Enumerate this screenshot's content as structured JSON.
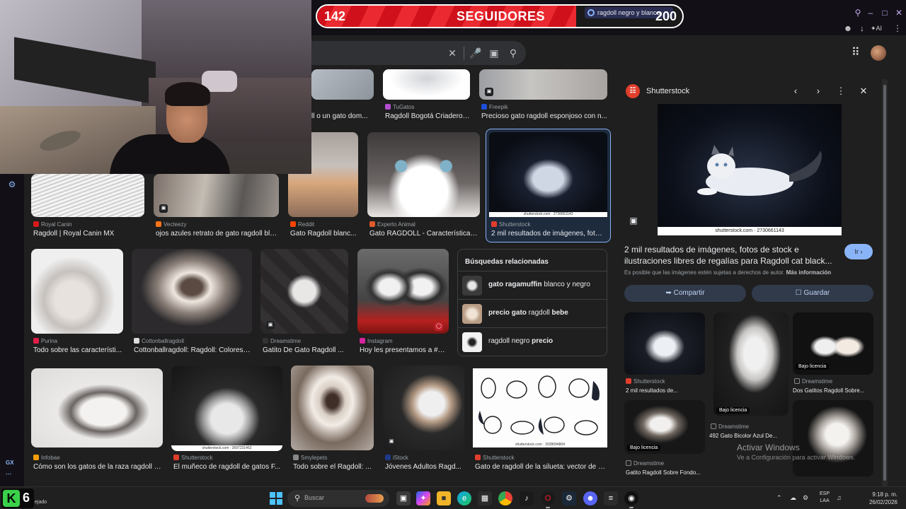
{
  "followers": {
    "current": 142,
    "label": "SEGUIDORES",
    "goal": 200,
    "progress_fraction": 0.71,
    "tab_title": "ragdoll negro y blanco"
  },
  "taskbar": {
    "logo_letter": "K",
    "logo_number": "6",
    "weather_text": "ejado",
    "search_label": "Buscar",
    "lang_top": "ESP",
    "lang_bottom": "LAA",
    "time": "9:18 p. m.",
    "date": "26/02/2026"
  },
  "rail": {
    "gx_label": "GX"
  },
  "grid": {
    "row0": [
      {
        "title": "ll o un gato dom..."
      },
      {
        "source": "TuGatos",
        "title": "Ragdoll Bogotá Criadero ..."
      },
      {
        "source": "Freepik",
        "title": "Precioso gato ragdoll esponjoso con n..."
      }
    ],
    "row1": [
      {
        "source": "Royal Canin",
        "title": "Ragdoll | Royal Canin MX"
      },
      {
        "source": "Vecteezy",
        "title": "ojos azules retrato de gato ragdoll bla..."
      },
      {
        "source": "Reddit",
        "title": "Gato Ragdoll blanc..."
      },
      {
        "source": "Experto Animal",
        "title": "Gato RAGDOLL - Características,..."
      },
      {
        "source": "Shutterstock",
        "title": "2 mil resultados de imágenes, foto..."
      }
    ],
    "row2": [
      {
        "source": "Purina",
        "title": "Todo sobre las característi..."
      },
      {
        "source": "Cottonballragdoll",
        "title": "Cottonballragdoll: Ragdoll: Colores ..."
      },
      {
        "source": "Dreamstime",
        "title": "Gatito De Gato Ragdoll ..."
      },
      {
        "source": "Instagram",
        "title": "Hoy les presentamos a #P..."
      }
    ],
    "row3": [
      {
        "source": "Infobae",
        "title": "Cómo son los gatos de la raza ragdoll - ..."
      },
      {
        "source": "Shutterstock",
        "title": "El muñeco de ragdoll de gatos F..."
      },
      {
        "source": "Smylepets",
        "title": "Todo sobre el Ragdoll: ..."
      },
      {
        "source": "iStock",
        "title": "Jóvenes Adultos Ragd..."
      },
      {
        "source": "Shutterstock",
        "title": "Gato de ragdoll de la silueta: vector de s..."
      }
    ],
    "selected_caption": "shutterstock.com · 2730661143",
    "shutter_caption": "shutterstock.com · 2697231462",
    "shutter_caption_b": "shutterstock.com · 2028094804"
  },
  "related": {
    "heading": "Búsquedas relacionadas",
    "items": [
      {
        "bold": "gato ragamuffin",
        "rest": " blanco y negro"
      },
      {
        "bold": "precio gato",
        "rest": " ragdoll ",
        "bold2": "bebe"
      },
      {
        "bold": "",
        "rest": "ragdoll negro ",
        "bold2": "precio"
      }
    ]
  },
  "panel": {
    "site": "Shutterstock",
    "image_caption": "shutterstock.com · 2730661143",
    "title": "2 mil resultados de imágenes, fotos de stock e ilustraciones libres de regalías para Ragdoll cat black...",
    "go_label": "Ir",
    "note": "Es posible que las imágenes estén sujetas a derechos de autor.",
    "note_link": "Más información",
    "share_label": "Compartir",
    "save_label": "Guardar",
    "tiles": [
      {
        "source": "Shutterstock",
        "title": "2 mil resultados de..."
      },
      {
        "source": "Dreamstime",
        "title": "492 Gato Bicolor Azul De...",
        "license": "Bajo licencia"
      },
      {
        "source": "Dreamstime",
        "title": "Dos Gatitos Ragdoll Sobre...",
        "license": "Bajo licencia"
      },
      {
        "source": "Dreamstime",
        "title": "Gatito Ragdoll Sobre Fondo...",
        "license": "Bajo licencia"
      }
    ]
  },
  "watermark": {
    "line1": "Activar Windows",
    "line2": "Ve a Configuración para activar Windows."
  },
  "colors": {
    "accent": "#8ab4f8",
    "counter_red": "#d0101a",
    "shutterstock": "#e03e2d"
  }
}
